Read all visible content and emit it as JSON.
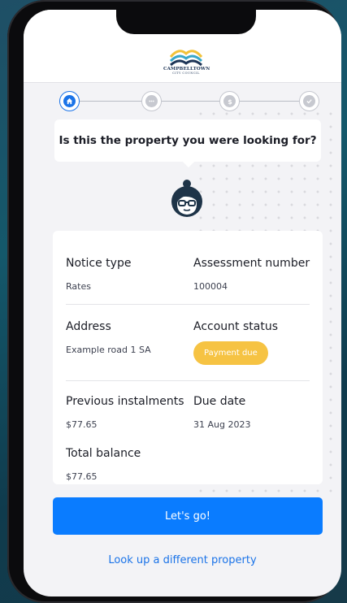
{
  "header": {
    "logo_name": "CAMPBELLTOWN",
    "logo_sub": "CITY COUNCIL"
  },
  "stepper": {
    "steps": [
      {
        "icon": "home-icon",
        "state": "active"
      },
      {
        "icon": "chat-icon",
        "state": "pending"
      },
      {
        "icon": "dollar-icon",
        "state": "pending"
      },
      {
        "icon": "check-icon",
        "state": "pending"
      }
    ]
  },
  "prompt": {
    "question": "Is this the property you were looking for?"
  },
  "property": {
    "notice_type_label": "Notice type",
    "notice_type_value": "Rates",
    "assessment_label": "Assessment number",
    "assessment_value": "100004",
    "address_label": "Address",
    "address_value": "Example road 1 SA",
    "account_status_label": "Account status",
    "account_status_value": "Payment due",
    "previous_instalments_label": "Previous instalments",
    "previous_instalments_value": "$77.65",
    "due_date_label": "Due date",
    "due_date_value": "31 Aug 2023",
    "total_balance_label": "Total balance",
    "total_balance_value": "$77.65"
  },
  "actions": {
    "primary_label": "Let's go!",
    "secondary_label": "Look up a different property"
  },
  "colors": {
    "accent": "#0a7cff",
    "badge": "#f6c343",
    "background": "#f3f3f6"
  }
}
